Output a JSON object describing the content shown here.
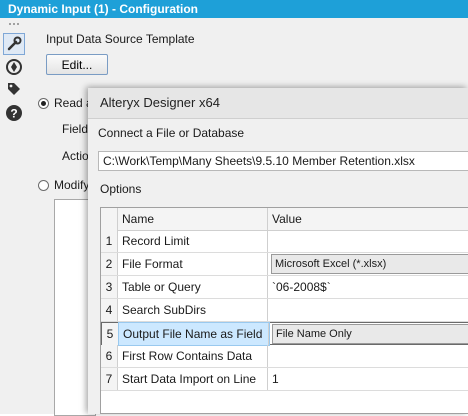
{
  "config_window": {
    "title": "Dynamic Input (1) - Configuration"
  },
  "toolbar": {
    "icons": [
      "wrench-icon",
      "navigation-icon",
      "tag-icon",
      "help-icon"
    ]
  },
  "config": {
    "template_label": "Input Data Source Template",
    "edit_button": "Edit...",
    "read_option": "Read a",
    "field_label": "Field",
    "action_label": "Actio",
    "modify_option": "Modify"
  },
  "dialog": {
    "title": "Alteryx Designer x64",
    "prompt": "Connect a File or Database",
    "path": "C:\\Work\\Temp\\Many Sheets\\9.5.10 Member Retention.xlsx",
    "options_label": "Options",
    "grid_headers": {
      "name": "Name",
      "value": "Value"
    },
    "rows": [
      {
        "num": "1",
        "name": "Record Limit",
        "value": ""
      },
      {
        "num": "2",
        "name": "File Format",
        "value": "Microsoft Excel (*.xlsx)"
      },
      {
        "num": "3",
        "name": "Table or Query",
        "value": "`06-2008$`"
      },
      {
        "num": "4",
        "name": "Search SubDirs",
        "value": ""
      },
      {
        "num": "5",
        "name": "Output File Name as Field",
        "value": "File Name Only"
      },
      {
        "num": "6",
        "name": "First Row Contains Data",
        "value": ""
      },
      {
        "num": "7",
        "name": "Start Data Import on Line",
        "value": "1"
      }
    ]
  },
  "colors": {
    "title_bar": "#1ea0d8",
    "selected_cell": "#cce8ff"
  }
}
